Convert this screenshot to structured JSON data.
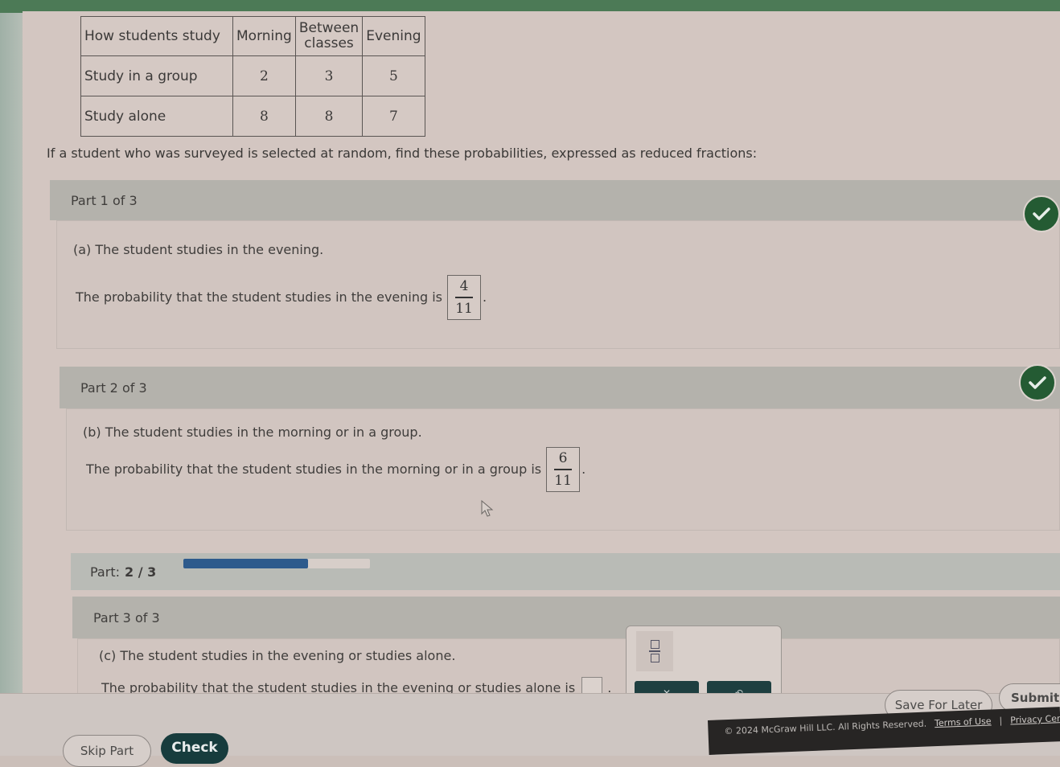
{
  "table": {
    "headers": [
      "How students study",
      "Morning",
      "Between classes",
      "Evening"
    ],
    "rows": [
      {
        "label": "Study in a group",
        "values": [
          "2",
          "3",
          "5"
        ]
      },
      {
        "label": "Study alone",
        "values": [
          "8",
          "8",
          "7"
        ]
      }
    ]
  },
  "instructions": "If a student who was surveyed is selected at random, find these probabilities, expressed as reduced fractions:",
  "parts": [
    {
      "header": "Part 1 of 3",
      "question": "(a) The student studies in the evening.",
      "answer_prefix": "The probability that the student studies in the evening is",
      "numerator": "4",
      "denominator": "11",
      "status": "correct",
      "suffix": "."
    },
    {
      "header": "Part 2 of 3",
      "question": "(b) The student studies in the morning or in a group.",
      "answer_prefix": "The probability that the student studies in the morning or in a group is",
      "numerator": "6",
      "denominator": "11",
      "status": "correct",
      "suffix": "."
    },
    {
      "header": "Part 3 of 3",
      "question": "(c) The student studies in the evening or studies alone.",
      "answer_prefix": "The probability that the student studies in the evening or studies alone is",
      "answer_value": "",
      "suffix": "."
    }
  ],
  "progress": {
    "label": "Part:",
    "current": "2 / 3",
    "fraction": 0.667,
    "color": "#2d5a8c"
  },
  "palette": {
    "template_icon": "fraction-template-icon",
    "buttons": [
      "✕",
      "↶"
    ]
  },
  "actions": {
    "skip_part": "Skip Part",
    "check": "Check",
    "save_for_later": "Save For Later",
    "submit": "Submit A"
  },
  "footer": {
    "copyright": "© 2024 McGraw Hill LLC. All Rights Reserved.",
    "terms": "Terms of Use",
    "separator": "|",
    "privacy": "Privacy Center"
  },
  "colors": {
    "check_green": "#245b33",
    "check_button": "#173c3d"
  }
}
